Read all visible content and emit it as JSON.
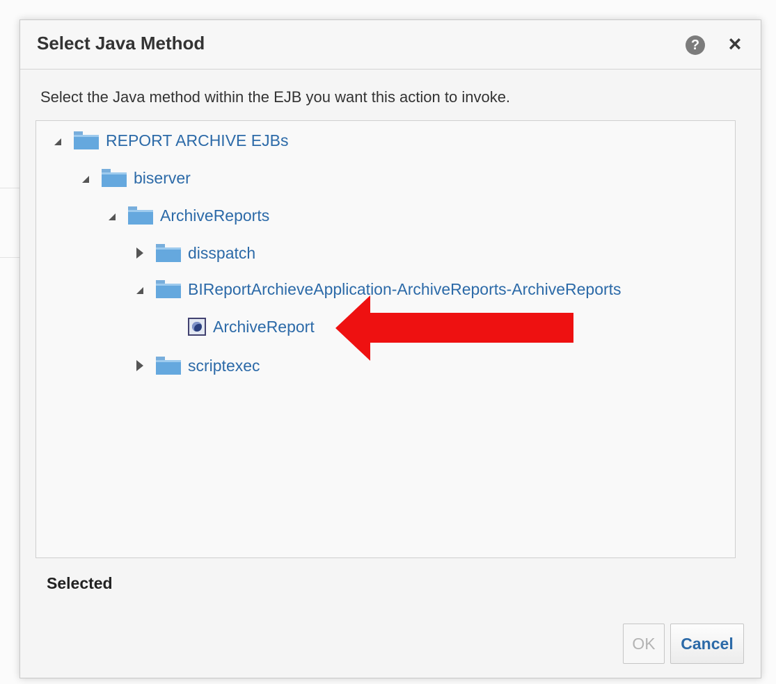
{
  "dialog": {
    "title": "Select Java Method",
    "help_icon": "?",
    "close_icon": "×",
    "instruction": "Select the Java method within the EJB you want this action to invoke.",
    "selected_label": "Selected"
  },
  "tree": {
    "root": {
      "label": "REPORT ARCHIVE EJBs",
      "state": "expanded",
      "icon": "folder-icon"
    },
    "biserver": {
      "label": "biserver",
      "state": "expanded",
      "icon": "folder-icon"
    },
    "archive_reports": {
      "label": "ArchiveReports",
      "state": "expanded",
      "icon": "folder-icon"
    },
    "disspatch": {
      "label": "disspatch",
      "state": "collapsed",
      "icon": "folder-icon"
    },
    "bi_app": {
      "label": "BIReportArchieveApplication-ArchiveReports-ArchiveReports",
      "state": "expanded",
      "icon": "folder-icon"
    },
    "archive_report": {
      "label": "ArchiveReport",
      "icon": "java-method-icon"
    },
    "scriptexec": {
      "label": "scriptexec",
      "state": "collapsed",
      "icon": "folder-icon"
    }
  },
  "buttons": {
    "ok": "OK",
    "cancel": "Cancel"
  },
  "colors": {
    "link": "#2c6aa8",
    "folder": "#65a8de",
    "annotation_arrow": "#ee1111"
  }
}
